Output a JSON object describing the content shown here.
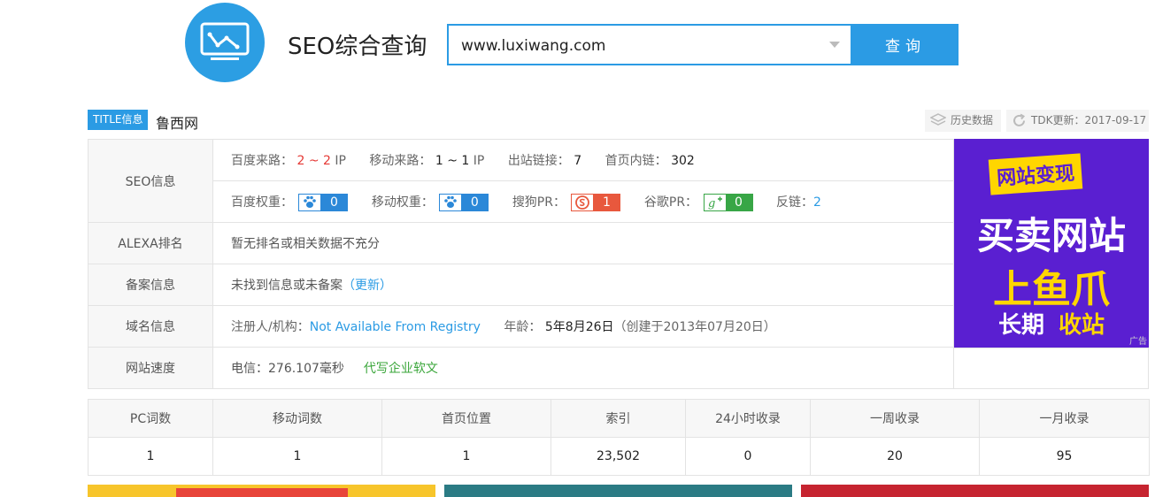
{
  "header": {
    "site_title": "SEO综合查询",
    "search_value": "www.luxiwang.com",
    "search_button": "查询"
  },
  "title_row": {
    "badge": "TITLE信息",
    "site_name": "鲁西网",
    "history_label": "历史数据",
    "tdk_label": "TDK更新：2017-09-17"
  },
  "seo": {
    "label": "SEO信息",
    "baidu_traffic_label": "百度来路：",
    "baidu_traffic_low": "2",
    "baidu_traffic_sep": "~",
    "baidu_traffic_high": "2",
    "baidu_traffic_unit": "IP",
    "mobile_traffic_label": "移动来路：",
    "mobile_traffic_value": "1 ~ 1",
    "mobile_traffic_unit": "IP",
    "outbound_label": "出站链接：",
    "outbound_value": "7",
    "inner_links_label": "首页内链：",
    "inner_links_value": "302",
    "baidu_weight_label": "百度权重：",
    "baidu_weight_value": "0",
    "mobile_weight_label": "移动权重：",
    "mobile_weight_value": "0",
    "sogou_pr_label": "搜狗PR：",
    "sogou_pr_value": "1",
    "google_pr_label": "谷歌PR：",
    "google_pr_value": "0",
    "backlinks_label": "反链：",
    "backlinks_value": "2"
  },
  "alexa": {
    "label": "ALEXA排名",
    "value": "暂无排名或相关数据不充分"
  },
  "beian": {
    "label": "备案信息",
    "value": "未找到信息或未备案",
    "update_link": "（更新）"
  },
  "domain": {
    "label": "域名信息",
    "registrant_label": "注册人/机构：",
    "registrant_value": "Not Available From Registry",
    "age_label": "年龄：",
    "age_value": "5年8月26日",
    "created": "（创建于2013年07月20日）"
  },
  "speed": {
    "label": "网站速度",
    "value": "电信：276.107毫秒",
    "link": "代写企业软文"
  },
  "ad": {
    "tag": "网站变现",
    "line1": "买卖网站",
    "line2": "上鱼爪",
    "line3a": "长期",
    "line3b": "收站",
    "small": "广告"
  },
  "stats": {
    "headers": [
      "PC词数",
      "移动词数",
      "首页位置",
      "索引",
      "24小时收录",
      "一周收录",
      "一月收录"
    ],
    "values": [
      "1",
      "1",
      "1",
      "23,502",
      "0",
      "20",
      "95"
    ]
  },
  "colors": {
    "accent": "#2b9be4",
    "red": "#e53935",
    "green": "#3aa63a"
  }
}
